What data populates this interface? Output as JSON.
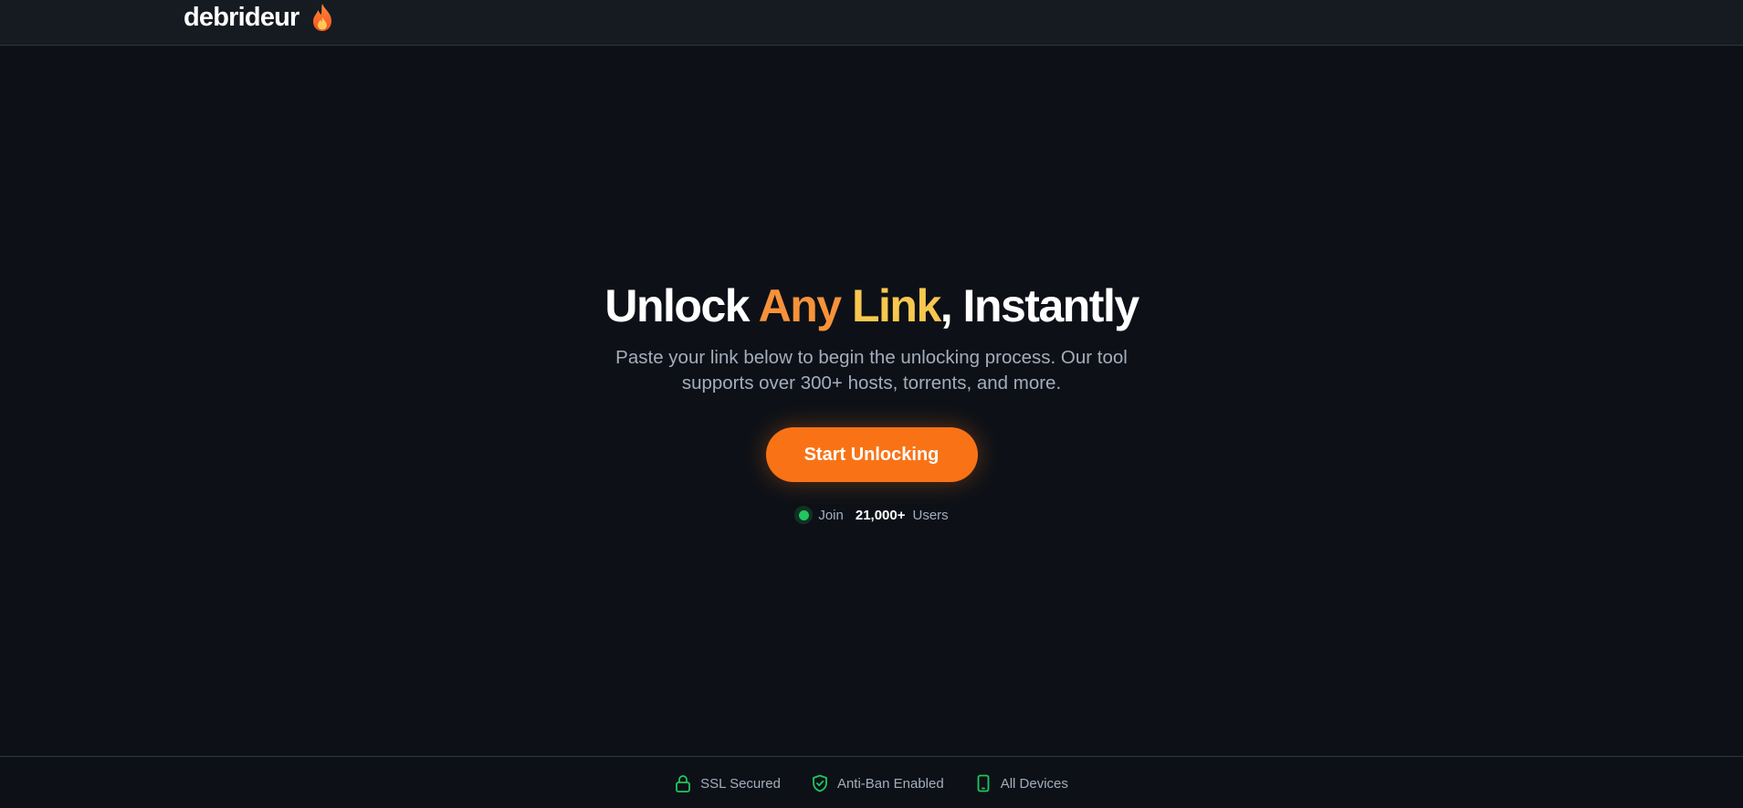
{
  "header": {
    "brand_name": "debrideur",
    "brand_icon": "flame-icon"
  },
  "hero": {
    "headline_part1": "Unlock ",
    "headline_highlight1": "Any ",
    "headline_highlight2": "Link",
    "headline_part2": ", Instantly",
    "subtitle": "Paste your link below to begin the unlocking process. Our tool supports over 300+ hosts, torrents, and more.",
    "cta_label": "Start Unlocking",
    "social_prefix": "Join",
    "social_count": "21,000+",
    "social_suffix": "Users"
  },
  "footer": {
    "badges": [
      {
        "label": "SSL Secured",
        "icon": "lock-icon"
      },
      {
        "label": "Anti-Ban Enabled",
        "icon": "shield-check-icon"
      },
      {
        "label": "All Devices",
        "icon": "smartphone-icon"
      }
    ]
  },
  "colors": {
    "background": "#0d1117",
    "accent": "#f97316",
    "highlight_orange": "#f7923a",
    "highlight_yellow": "#f9c74f",
    "success": "#22c55e"
  }
}
